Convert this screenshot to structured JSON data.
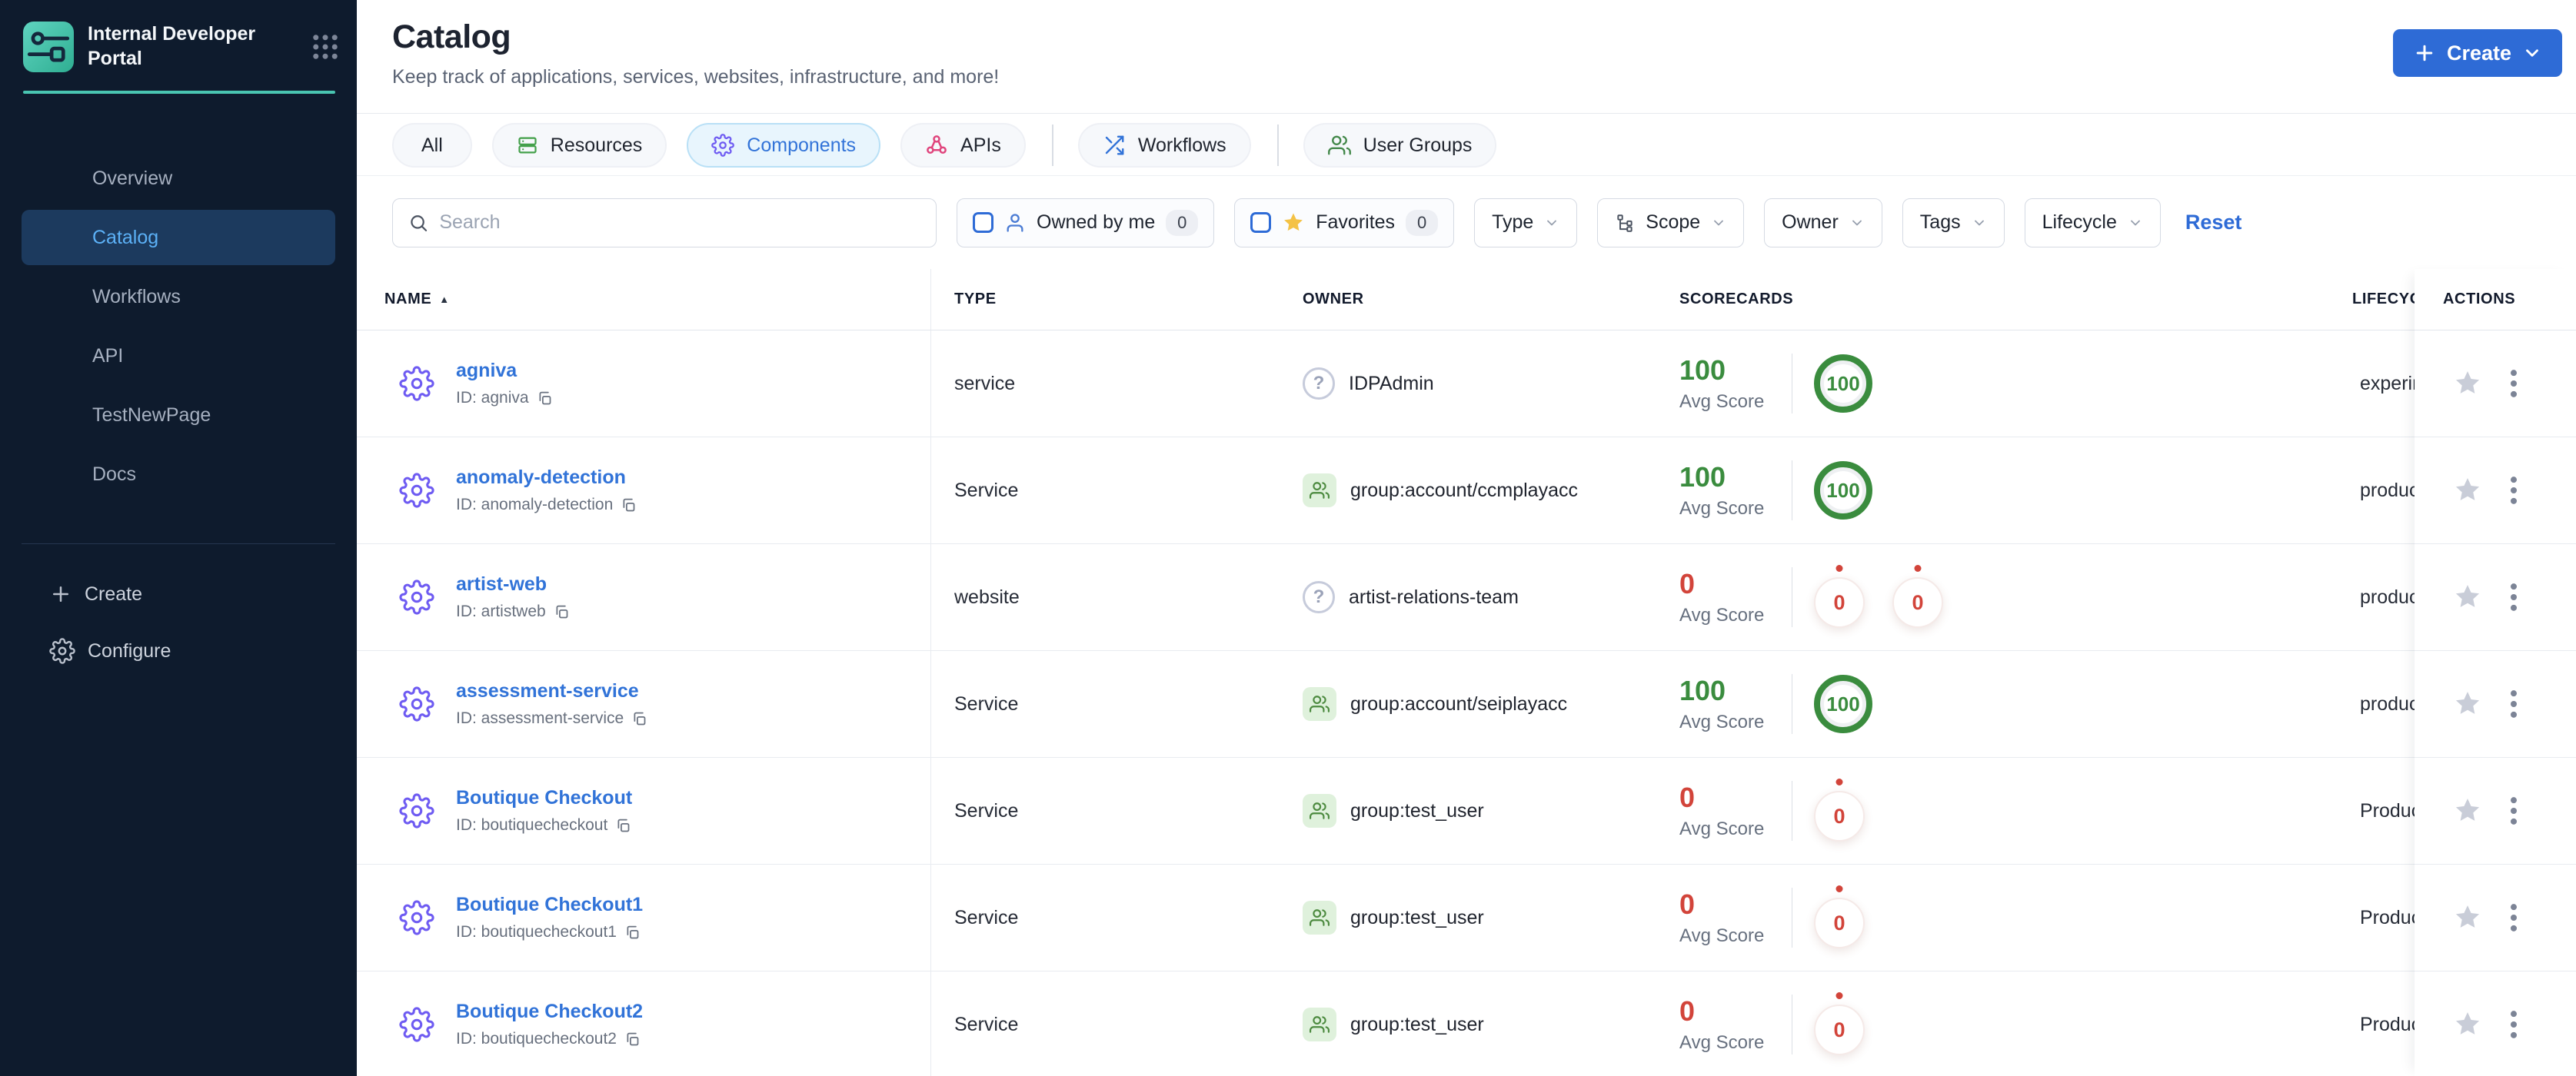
{
  "sidebar": {
    "logo_title": "Internal Developer Portal",
    "nav": [
      {
        "label": "Overview",
        "active": false
      },
      {
        "label": "Catalog",
        "active": true
      },
      {
        "label": "Workflows",
        "active": false
      },
      {
        "label": "API",
        "active": false
      },
      {
        "label": "TestNewPage",
        "active": false
      },
      {
        "label": "Docs",
        "active": false
      }
    ],
    "footer": [
      {
        "label": "Create"
      },
      {
        "label": "Configure"
      }
    ]
  },
  "header": {
    "title": "Catalog",
    "subtitle": "Keep track of applications, services, websites, infrastructure, and more!",
    "create_label": "Create"
  },
  "tabs": {
    "items": [
      {
        "label": "All",
        "active": false
      },
      {
        "label": "Resources",
        "active": false
      },
      {
        "label": "Components",
        "active": true
      },
      {
        "label": "APIs",
        "active": false
      },
      {
        "label": "Workflows",
        "active": false
      },
      {
        "label": "User Groups",
        "active": false
      }
    ]
  },
  "filters": {
    "search_placeholder": "Search",
    "owned_by_me": {
      "label": "Owned by me",
      "count": "0",
      "checked": false
    },
    "favorites": {
      "label": "Favorites",
      "count": "0",
      "checked": false
    },
    "dropdowns": [
      {
        "label": "Type"
      },
      {
        "label": "Scope"
      },
      {
        "label": "Owner"
      },
      {
        "label": "Tags"
      },
      {
        "label": "Lifecycle"
      }
    ],
    "reset_label": "Reset"
  },
  "table": {
    "columns": {
      "name": "NAME",
      "type": "TYPE",
      "owner": "OWNER",
      "scorecards": "SCORECARDS",
      "lifecycle": "LIFECYCLE",
      "actions": "ACTIONS"
    },
    "avg_caption": "Avg Score",
    "rows": [
      {
        "name": "agniva",
        "id": "ID: agniva",
        "type": "service",
        "owner": {
          "kind": "unknown",
          "label": "IDPAdmin"
        },
        "score": {
          "avg": "100",
          "state": "good",
          "circles": [
            {
              "value": "100",
              "state": "good"
            }
          ]
        },
        "lifecycle": "experimental"
      },
      {
        "name": "anomaly-detection",
        "id": "ID: anomaly-detection",
        "type": "Service",
        "owner": {
          "kind": "group",
          "label": "group:account/ccmplayacc"
        },
        "score": {
          "avg": "100",
          "state": "good",
          "circles": [
            {
              "value": "100",
              "state": "good"
            }
          ]
        },
        "lifecycle": "production"
      },
      {
        "name": "artist-web",
        "id": "ID: artistweb",
        "type": "website",
        "owner": {
          "kind": "unknown",
          "label": "artist-relations-team"
        },
        "score": {
          "avg": "0",
          "state": "bad",
          "circles": [
            {
              "value": "0",
              "state": "bad"
            },
            {
              "value": "0",
              "state": "bad"
            }
          ]
        },
        "lifecycle": "production"
      },
      {
        "name": "assessment-service",
        "id": "ID: assessment-service",
        "type": "Service",
        "owner": {
          "kind": "group",
          "label": "group:account/seiplayacc"
        },
        "score": {
          "avg": "100",
          "state": "good",
          "circles": [
            {
              "value": "100",
              "state": "good"
            }
          ]
        },
        "lifecycle": "production"
      },
      {
        "name": "Boutique Checkout",
        "id": "ID: boutiquecheckout",
        "type": "Service",
        "owner": {
          "kind": "group",
          "label": "group:test_user"
        },
        "score": {
          "avg": "0",
          "state": "bad",
          "circles": [
            {
              "value": "0",
              "state": "bad"
            }
          ]
        },
        "lifecycle": "Production"
      },
      {
        "name": "Boutique Checkout1",
        "id": "ID: boutiquecheckout1",
        "type": "Service",
        "owner": {
          "kind": "group",
          "label": "group:test_user"
        },
        "score": {
          "avg": "0",
          "state": "bad",
          "circles": [
            {
              "value": "0",
              "state": "bad"
            }
          ]
        },
        "lifecycle": "Production"
      },
      {
        "name": "Boutique Checkout2",
        "id": "ID: boutiquecheckout2",
        "type": "Service",
        "owner": {
          "kind": "group",
          "label": "group:test_user"
        },
        "score": {
          "avg": "0",
          "state": "bad",
          "circles": [
            {
              "value": "0",
              "state": "bad"
            }
          ]
        },
        "lifecycle": "Production"
      }
    ]
  },
  "colors": {
    "sidebar_bg": "#0e1b2d",
    "sidebar_active_bg": "#1c3a5e",
    "sidebar_active_text": "#5cb1f7",
    "teal_accent": "#49c5b1",
    "primary_blue": "#2e6bd6",
    "link_blue": "#3173d8",
    "score_green": "#3a8c3e",
    "score_red": "#d2443a",
    "component_purple": "#6e5bf2",
    "api_pink": "#e0447c",
    "resource_green": "#43a04a",
    "favorite_yellow": "#f4c245"
  }
}
